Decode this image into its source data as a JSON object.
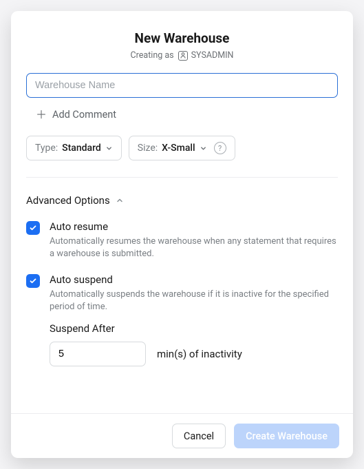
{
  "header": {
    "title": "New Warehouse",
    "creating_as_prefix": "Creating as",
    "role": "SYSADMIN"
  },
  "form": {
    "name_placeholder": "Warehouse Name",
    "name_value": "",
    "add_comment_label": "Add Comment",
    "type": {
      "label": "Type:",
      "value": "Standard"
    },
    "size": {
      "label": "Size:",
      "value": "X-Small"
    }
  },
  "advanced": {
    "section_label": "Advanced Options",
    "auto_resume": {
      "checked": true,
      "title": "Auto resume",
      "desc": "Automatically resumes the warehouse when any statement that requires a warehouse is submitted."
    },
    "auto_suspend": {
      "checked": true,
      "title": "Auto suspend",
      "desc": "Automatically suspends the warehouse if it is inactive for the specified period of time.",
      "suspend_after_label": "Suspend After",
      "suspend_after_value": "5",
      "suspend_after_unit": "min(s) of inactivity"
    }
  },
  "footer": {
    "cancel": "Cancel",
    "create": "Create Warehouse"
  }
}
